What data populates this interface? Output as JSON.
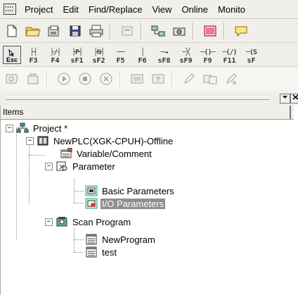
{
  "menubar": {
    "items": [
      "Project",
      "Edit",
      "Find/Replace",
      "View",
      "Online",
      "Monito"
    ]
  },
  "toolbar_fkeys": {
    "esc": "Esc",
    "keys": [
      {
        "sym": "├┤",
        "label": "F3"
      },
      {
        "sym": "├/┤",
        "label": "F4"
      },
      {
        "sym": "├P┤",
        "label": "sF1"
      },
      {
        "sym": "├N┤",
        "label": "sF2"
      },
      {
        "sym": "──",
        "label": "F5"
      },
      {
        "sym": "│",
        "label": "F6"
      },
      {
        "sym": "─→",
        "label": "sF8"
      },
      {
        "sym": "─╳",
        "label": "sF9"
      },
      {
        "sym": "─()─",
        "label": "F9"
      },
      {
        "sym": "─(/)",
        "label": "F11"
      },
      {
        "sym": "─(S",
        "label": "sF"
      }
    ]
  },
  "panel": {
    "header": "Items"
  },
  "tree": {
    "project": "Project *",
    "plc": "NewPLC(XGK-CPUH)-Offline",
    "variable": "Variable/Comment",
    "parameter": "Parameter",
    "basic_params": "Basic Parameters",
    "io_params": "I/O Parameters",
    "scan_program": "Scan Program",
    "new_program": "NewProgram",
    "test": "test"
  },
  "colors": {
    "chrome": "#f0efe9",
    "selection": "#8f8f8f"
  }
}
